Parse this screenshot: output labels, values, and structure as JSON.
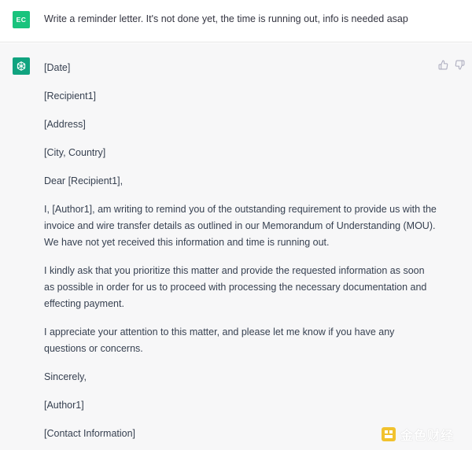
{
  "user": {
    "initials": "EC",
    "message": "Write a reminder letter. It's not done yet, the time is running out, info is needed asap"
  },
  "assistant": {
    "paragraphs": [
      "[Date]",
      "[Recipient1]",
      "[Address]",
      "[City, Country]",
      "Dear [Recipient1],",
      "I, [Author1], am writing to remind you of the outstanding requirement to provide us with the invoice and wire transfer details as outlined in our Memorandum of Understanding (MOU). We have not yet received this information and time is running out.",
      "I kindly ask that you prioritize this matter and provide the requested information as soon as possible in order for us to proceed with processing the necessary documentation and effecting payment.",
      "I appreciate your attention to this matter, and please let me know if you have any questions or concerns.",
      "Sincerely,",
      "[Author1]",
      "[Contact Information]"
    ]
  },
  "icons": {
    "user_avatar_color": "#19c37d",
    "assistant_avatar_color": "#10a37f",
    "assistant_avatar": "openai-logo-icon",
    "feedback_up": "thumbs-up-icon",
    "feedback_down": "thumbs-down-icon"
  },
  "watermark": {
    "text": "金色财经"
  }
}
